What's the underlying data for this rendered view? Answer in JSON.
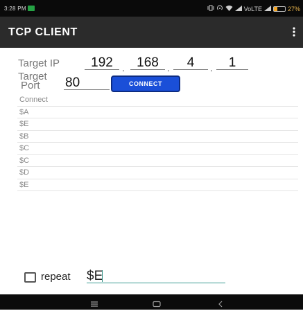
{
  "status_bar": {
    "time": "3:28 PM",
    "network_label": "VoLTE",
    "battery_percent": "27%",
    "icons": [
      "notification-icon",
      "vibrate-icon",
      "hotspot-icon",
      "wifi-icon",
      "signal-icon",
      "battery-icon"
    ]
  },
  "app_bar": {
    "title": "TCP CLIENT",
    "menu_icon": "overflow-menu-icon"
  },
  "form": {
    "target_ip_label": "Target IP",
    "ip": [
      "192",
      "168",
      "4",
      "1"
    ],
    "ip_separator": ".",
    "target_port_label_line1": "Target",
    "target_port_label_line2": "Port",
    "port": "80",
    "connect_label": "CONNECT"
  },
  "log": {
    "lines": [
      "Connect",
      "$A",
      "$E",
      "$B",
      "$C",
      "$C",
      "$D",
      "$E"
    ]
  },
  "repeat": {
    "checked": false,
    "label": "repeat",
    "command": "$E"
  },
  "nav_bar": {
    "icons": [
      "menu-icon",
      "home-icon",
      "back-icon"
    ]
  },
  "colors": {
    "app_bar": "#2b2b2b",
    "connect_button": "#1a4fd8",
    "input_underline_active": "#3a9a90"
  }
}
